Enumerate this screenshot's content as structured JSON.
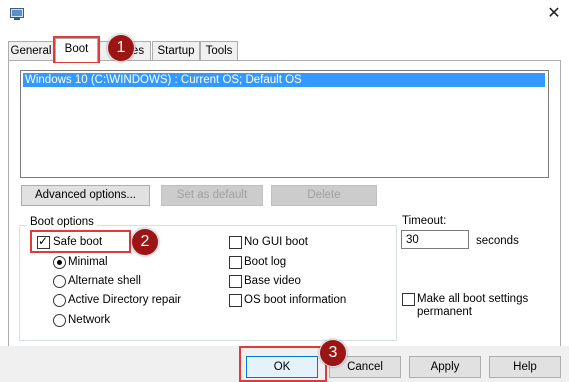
{
  "tabs": [
    {
      "label": "General"
    },
    {
      "label": "Boot"
    },
    {
      "label": "Services"
    },
    {
      "label": "Startup"
    },
    {
      "label": "Tools"
    }
  ],
  "tab_hidden_fragment": "es",
  "os_list": {
    "items": [
      "Windows 10 (C:\\WINDOWS) : Current OS; Default OS"
    ]
  },
  "buttons": {
    "advanced": "Advanced options...",
    "set_default": "Set as default",
    "delete": "Delete"
  },
  "boot_options": {
    "legend": "Boot options",
    "safe_boot": {
      "label": "Safe boot",
      "checked": true
    },
    "radios": [
      {
        "label": "Minimal",
        "selected": true
      },
      {
        "label": "Alternate shell",
        "selected": false
      },
      {
        "label": "Active Directory repair",
        "selected": false
      },
      {
        "label": "Network",
        "selected": false
      }
    ],
    "checks": [
      {
        "label": "No GUI boot",
        "checked": false
      },
      {
        "label": "Boot log",
        "checked": false
      },
      {
        "label": "Base video",
        "checked": false
      },
      {
        "label": "OS boot information",
        "checked": false
      }
    ]
  },
  "timeout": {
    "label": "Timeout:",
    "value": "30",
    "unit": "seconds"
  },
  "make_permanent": {
    "label_line1": "Make all boot settings",
    "label_line2": "permanent",
    "checked": false
  },
  "footer": {
    "ok": "OK",
    "cancel": "Cancel",
    "apply": "Apply",
    "help": "Help"
  },
  "annotations": [
    "1",
    "2",
    "3"
  ],
  "colors": {
    "selection": "#3399ff",
    "highlight": "#e03a3a",
    "badge": "#9b1515"
  }
}
